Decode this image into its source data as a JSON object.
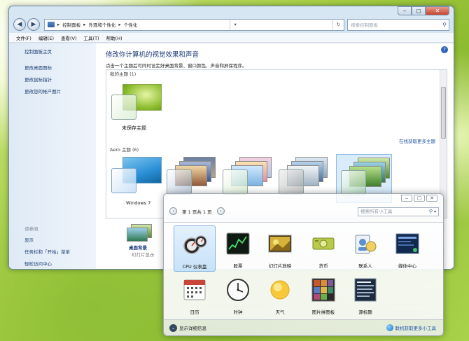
{
  "explorer": {
    "title_controls": {
      "minimize": "‒",
      "maximize": "▢",
      "close": "✕"
    },
    "nav": {
      "back": "◀",
      "forward": "▶"
    },
    "address": [
      "控制面板",
      "外观和个性化",
      "个性化"
    ],
    "address_sep": "▸",
    "address_dropdown": "▾",
    "refresh": "↻",
    "search_placeholder": "搜索控制面板",
    "menu": [
      "文件(F)",
      "编辑(E)",
      "查看(V)",
      "工具(T)",
      "帮助(H)"
    ],
    "sidebar": {
      "home": "控制面板主页",
      "links": [
        "更改桌面图标",
        "更改鼠标指针",
        "更改您的帐户图片"
      ],
      "see_also_title": "请参阅",
      "see_also": [
        "显示",
        "任务栏和「开始」菜单",
        "轻松访问中心"
      ]
    },
    "content": {
      "help": "?",
      "title": "修改你计算机的视觉效果和声音",
      "description": "点击一个主题后可同时设定好桌面背景、窗口颜色、声音和屏保程序。",
      "my_themes_label": "我的主题 (1)",
      "unsaved_theme": "未保存主题",
      "online_link": "在线获取更多主题",
      "aero_label": "Aero 主题 (6)",
      "aero_first": "Windows 7",
      "desktop_background": "桌面背景",
      "slideshow": "幻灯片显示"
    }
  },
  "gadgets": {
    "controls": {
      "minimize": "‒",
      "maximize": "▢",
      "close": "✕"
    },
    "nav_prev": "‹",
    "nav_next": "›",
    "page_label": "第 1 页共 1 页",
    "search_placeholder": "搜索所有小工具",
    "search_dropdown": "▾",
    "items": [
      {
        "label": "CPU 仪表盘",
        "icon": "cpu-meter-icon"
      },
      {
        "label": "股票",
        "icon": "stocks-icon"
      },
      {
        "label": "幻灯片放映",
        "icon": "slideshow-icon"
      },
      {
        "label": "货币",
        "icon": "currency-icon"
      },
      {
        "label": "联系人",
        "icon": "contacts-icon"
      },
      {
        "label": "媒体中心",
        "icon": "media-center-icon"
      },
      {
        "label": "日历",
        "icon": "calendar-icon"
      },
      {
        "label": "时钟",
        "icon": "clock-icon"
      },
      {
        "label": "天气",
        "icon": "weather-icon"
      },
      {
        "label": "图片拼图板",
        "icon": "picture-puzzle-icon"
      },
      {
        "label": "源标题",
        "icon": "feed-headlines-icon"
      }
    ],
    "selected_index": 0,
    "show_details": "显示详细信息",
    "details_chevron": "⌄",
    "online_link": "联机获取更多小工具"
  }
}
